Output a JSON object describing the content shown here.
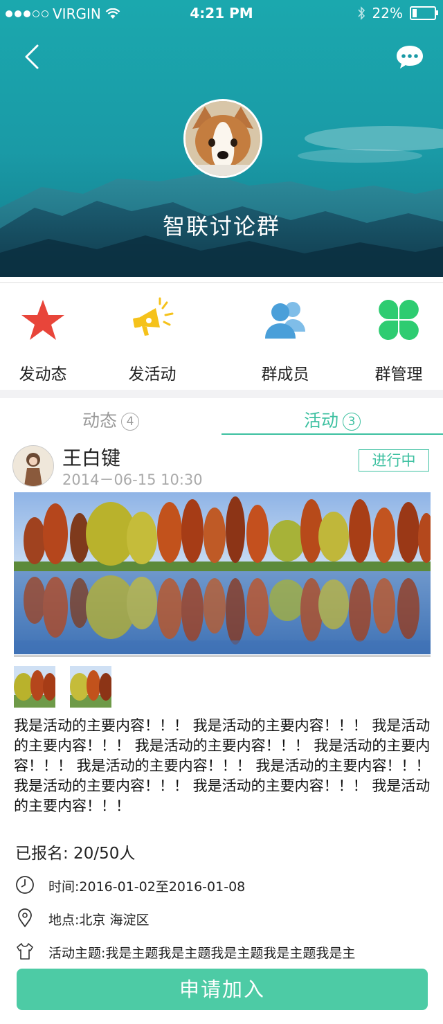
{
  "status_bar": {
    "carrier": "VIRGIN",
    "time": "4:21 PM",
    "battery": "22%",
    "battery_level": 0.22
  },
  "header": {
    "group_name": "智联讨论群",
    "back_icon": "back-arrow-icon",
    "chat_icon": "chat-bubble-icon"
  },
  "actions": [
    {
      "label": "发动态",
      "icon": "star-icon",
      "color": "#e8453a"
    },
    {
      "label": "发活动",
      "icon": "megaphone-icon",
      "color": "#f5c21b"
    },
    {
      "label": "群成员",
      "icon": "members-icon",
      "color": "#4a9fd9"
    },
    {
      "label": "群管理",
      "icon": "clover-icon",
      "color": "#2ecc71"
    }
  ],
  "tabs": [
    {
      "label": "动态",
      "count": "4",
      "active": false
    },
    {
      "label": "活动",
      "count": "3",
      "active": true
    }
  ],
  "post": {
    "author": "王白键",
    "time": "2014－06-15  10:30",
    "status": "进行中",
    "content": "我是活动的主要内容！！！ 我是活动的主要内容！！！ 我是活动的主要内容！！！ 我是活动的主要内容！！！ 我是活动的主要内容！！！ 我是活动的主要内容！！！ 我是活动的主要内容！！！ 我是活动的主要内容！！！ 我是活动的主要内容！！！ 我是活动的主要内容！！！",
    "enrolled": "已报名:  20/50人",
    "time_info": "时间:2016-01-02至2016-01-08",
    "location": "地点:北京 海淀区",
    "theme": "活动主题:我是主题我是主题我是主题我是主题我是主",
    "join_button": "申请加入"
  },
  "colors": {
    "accent": "#3cc0a0",
    "join": "#4dcba5"
  }
}
